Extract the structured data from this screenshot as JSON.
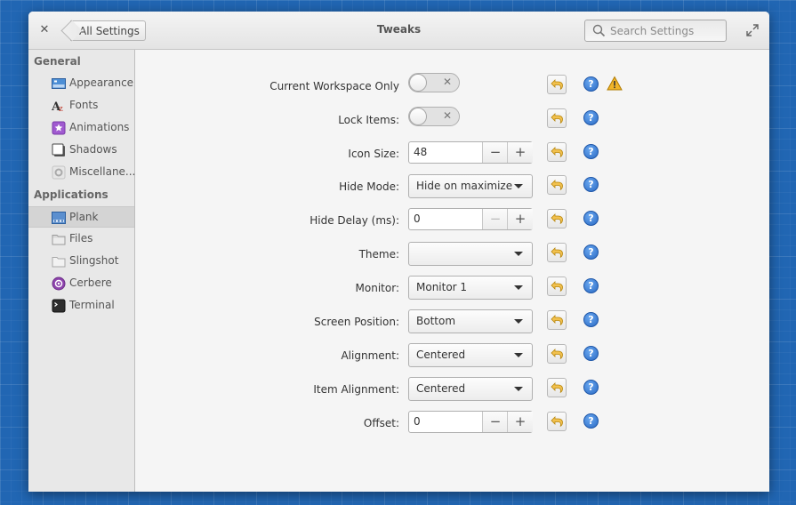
{
  "window": {
    "title": "Tweaks"
  },
  "header": {
    "back_label": "All Settings",
    "search_placeholder": "Search Settings"
  },
  "sidebar": {
    "sections": [
      {
        "title": "General",
        "items": [
          {
            "label": "Appearance",
            "icon": "appearance-icon"
          },
          {
            "label": "Fonts",
            "icon": "fonts-icon"
          },
          {
            "label": "Animations",
            "icon": "animations-icon"
          },
          {
            "label": "Shadows",
            "icon": "shadows-icon"
          },
          {
            "label": "Miscellane...",
            "icon": "miscellaneous-icon"
          }
        ]
      },
      {
        "title": "Applications",
        "items": [
          {
            "label": "Plank",
            "icon": "plank-icon",
            "selected": true
          },
          {
            "label": "Files",
            "icon": "folder-icon"
          },
          {
            "label": "Slingshot",
            "icon": "slingshot-icon"
          },
          {
            "label": "Cerbere",
            "icon": "cerbere-icon"
          },
          {
            "label": "Terminal",
            "icon": "terminal-icon"
          }
        ]
      }
    ]
  },
  "settings": [
    {
      "label": "Current Workspace Only",
      "control": "switch",
      "state": "off",
      "state_symbol": "✕",
      "warning": true
    },
    {
      "label": "Lock Items:",
      "control": "switch",
      "state": "off",
      "state_symbol": "✕"
    },
    {
      "label": "Icon Size:",
      "control": "spin",
      "value": "48"
    },
    {
      "label": "Hide Mode:",
      "control": "combo",
      "value": "Hide on maximize"
    },
    {
      "label": "Hide Delay (ms):",
      "control": "spin",
      "value": "0"
    },
    {
      "label": "Theme:",
      "control": "combo",
      "value": ""
    },
    {
      "label": "Monitor:",
      "control": "combo",
      "value": "Monitor 1"
    },
    {
      "label": "Screen Position:",
      "control": "combo",
      "value": "Bottom"
    },
    {
      "label": "Alignment:",
      "control": "combo",
      "value": "Centered"
    },
    {
      "label": "Item Alignment:",
      "control": "combo",
      "value": "Centered"
    },
    {
      "label": "Offset:",
      "control": "spin",
      "value": "0"
    }
  ],
  "glyphs": {
    "close": "✕",
    "minus": "−",
    "plus": "+",
    "help": "?"
  },
  "colors": {
    "accent": "#2a6ac4",
    "desktop": "#2166b3",
    "warning": "#f0b429"
  }
}
